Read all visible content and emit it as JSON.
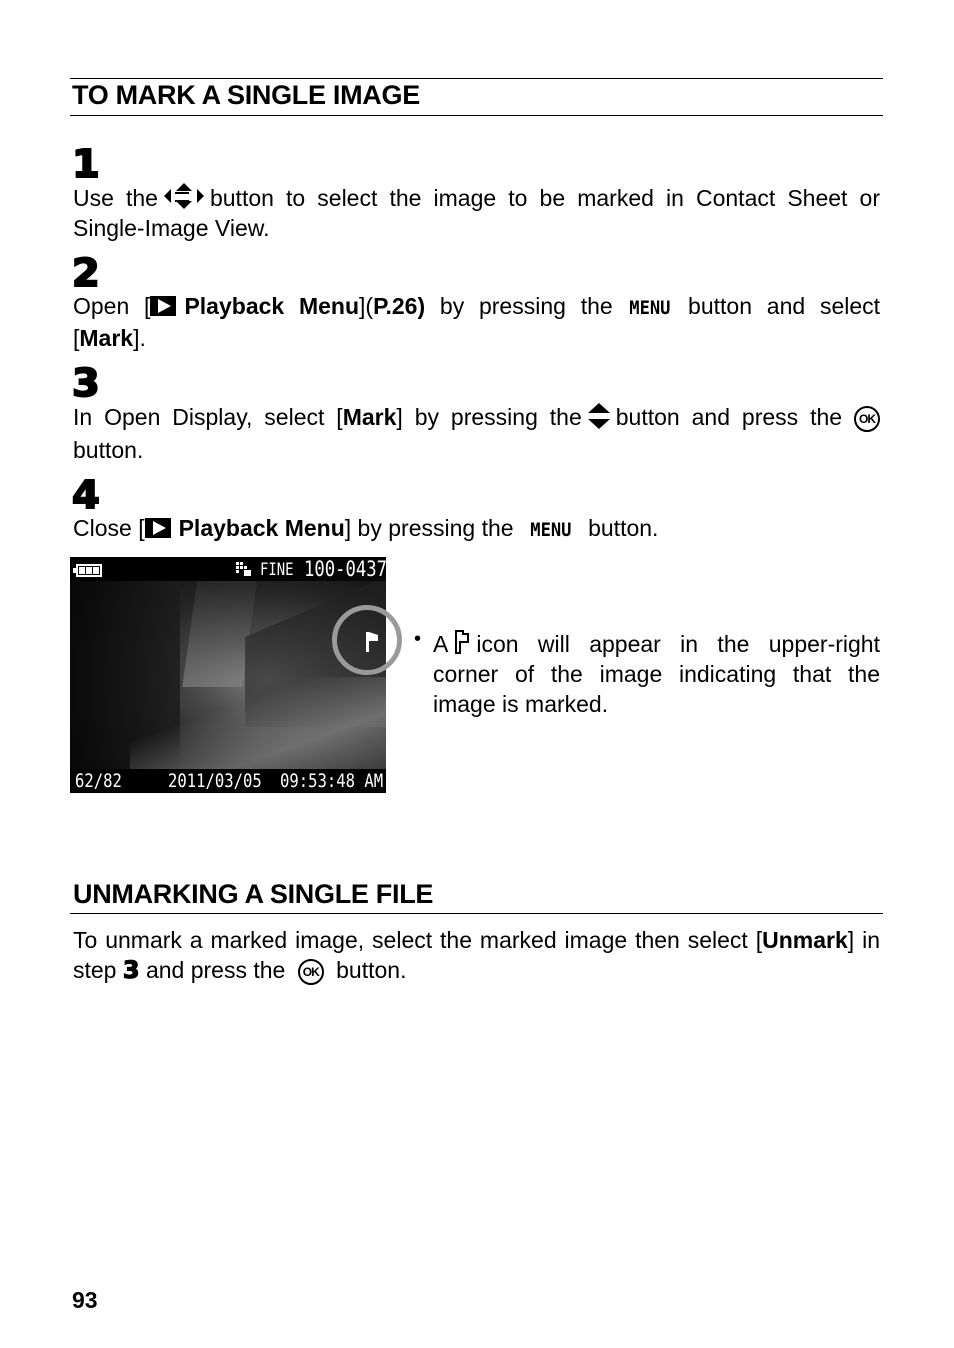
{
  "section1": {
    "heading": "TO MARK A SINGLE IMAGE",
    "steps": [
      {
        "number": "1",
        "text_a": "Use the",
        "icon": "four-way-arrow-icon",
        "text_b": "button to select the image to be marked in Contact Sheet or Single-Image View."
      },
      {
        "number": "2",
        "text_a": "Open [",
        "icon": "playback-icon",
        "menu_name": "Playback Menu",
        "text_b": "](",
        "page_ref": "P.26)",
        "text_c": " by pressing the",
        "button_word": "MENU",
        "text_d": "button and select [",
        "item": "Mark",
        "text_e": "]."
      },
      {
        "number": "3",
        "text_a": "In Open Display, select [",
        "item": "Mark",
        "text_b": "] by pressing the",
        "icon": "up-down-arrow-icon",
        "text_c": "button and press the",
        "ok_label": "OK",
        "text_d": "button."
      },
      {
        "number": "4",
        "text_a": "Close [",
        "icon": "playback-icon",
        "menu_name": "Playback Menu",
        "text_b": "] by pressing the",
        "button_word": "MENU",
        "text_c": "button."
      }
    ],
    "camera_screen": {
      "battery": "full",
      "quality": "FINE",
      "file_number": "100-0437",
      "frame_counter": "62/82",
      "date": "2011/03/05",
      "time": "09:53:48 AM",
      "mark_icon": "flag-icon"
    },
    "note": {
      "bullet": "•",
      "text_a": "A",
      "icon": "flag-icon",
      "text_b": "icon will appear in the upper-right corner of the image indicating that the image is marked."
    }
  },
  "section2": {
    "heading": "UNMARKING A SINGLE FILE",
    "text_a": "To unmark a marked image, select the marked image then select [",
    "item": "Unmark",
    "text_b": "] in step",
    "step_ref": "3",
    "text_c": "and press the",
    "ok_label": "OK",
    "text_d": "button."
  },
  "page_number": "93"
}
